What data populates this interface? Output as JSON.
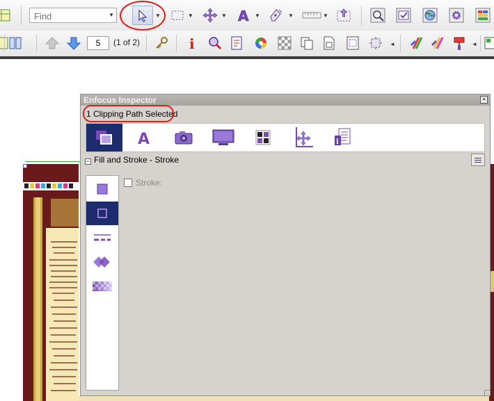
{
  "toolbar": {
    "find_placeholder": "Find",
    "page_number": "5",
    "page_of": "(1 of 2)"
  },
  "inspector": {
    "title": "Enfocus Inspector",
    "status": "1 Clipping Path Selected",
    "close_glyph": "×",
    "tabs": [
      "fill-stroke-icon",
      "text-icon",
      "image-icon",
      "monitor-icon",
      "grid-icon",
      "position-icon",
      "info-icon"
    ],
    "section_title": "Fill and Stroke - Stroke",
    "stroke_label": "Stroke:",
    "stroke_checked": false
  },
  "colors": {
    "accent": "#1c2c6c",
    "icon_purple": "#7a4ab8",
    "highlight_red": "#e41b1b",
    "panel_bg": "#d6d3ce",
    "document_red": "#6b1a1c"
  }
}
